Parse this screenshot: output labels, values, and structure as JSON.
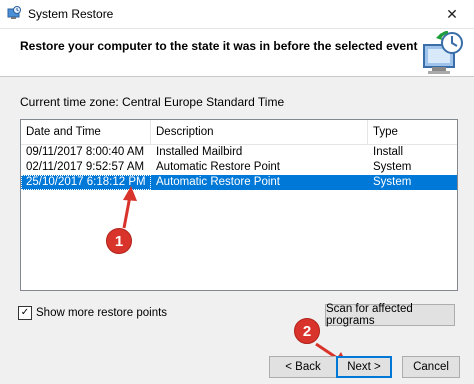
{
  "window": {
    "title": "System Restore",
    "close_glyph": "✕"
  },
  "header": {
    "heading": "Restore your computer to the state it was in before the selected event"
  },
  "timezone_label": "Current time zone: Central Europe Standard Time",
  "table": {
    "columns": [
      "Date and Time",
      "Description",
      "Type"
    ],
    "rows": [
      {
        "date": "09/11/2017 8:00:40 AM",
        "description": "Installed Mailbird",
        "type": "Install",
        "selected": false
      },
      {
        "date": "02/11/2017 9:52:57 AM",
        "description": "Automatic Restore Point",
        "type": "System",
        "selected": false
      },
      {
        "date": "25/10/2017 6:18:12 PM",
        "description": "Automatic Restore Point",
        "type": "System",
        "selected": true
      }
    ]
  },
  "show_more": {
    "label": "Show more restore points",
    "checked": true
  },
  "buttons": {
    "scan": "Scan for affected programs",
    "back": "< Back",
    "next": "Next >",
    "cancel": "Cancel"
  },
  "callouts": [
    "1",
    "2"
  ],
  "colors": {
    "selection": "#0078d7",
    "callout": "#d9342b"
  }
}
